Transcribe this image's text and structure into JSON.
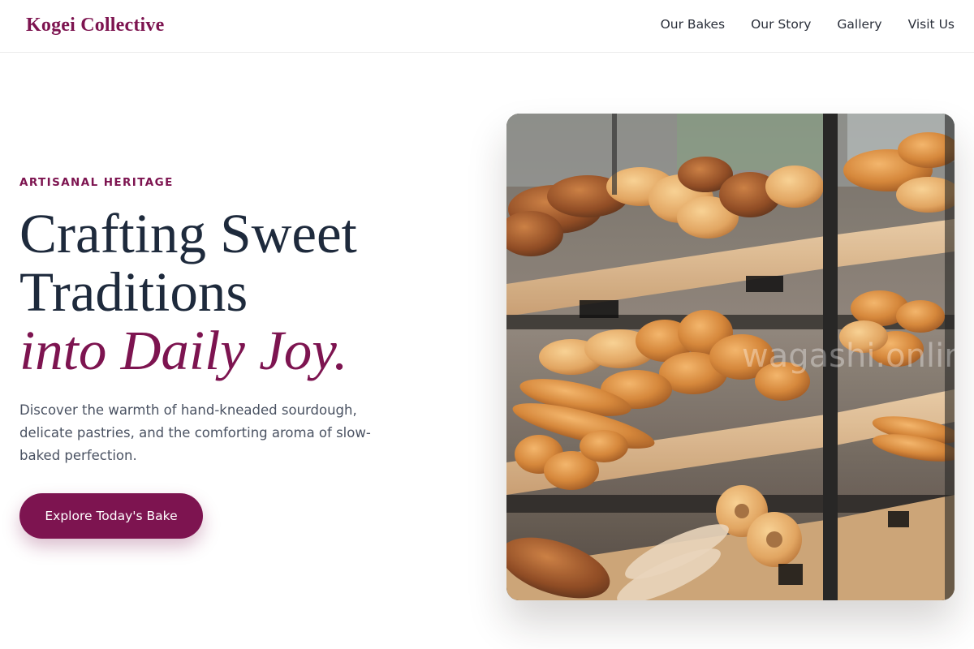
{
  "header": {
    "brand": "Kogei Collective",
    "nav": [
      {
        "label": "Our Bakes"
      },
      {
        "label": "Our Story"
      },
      {
        "label": "Gallery"
      },
      {
        "label": "Visit Us"
      }
    ]
  },
  "hero": {
    "eyebrow": "ARTISANAL HERITAGE",
    "headline_line1": "Crafting Sweet",
    "headline_line2": "Traditions",
    "headline_accent": "into Daily Joy.",
    "description": "Discover the warmth of hand-kneaded sourdough, delicate pastries, and the comforting aroma of slow-baked perfection.",
    "cta_label": "Explore Today's Bake",
    "image_alt": "Glass display case filled with breads and pastries",
    "watermark": "wagashi.online"
  },
  "colors": {
    "brand": "#7d1450",
    "heading": "#1e2a3c",
    "body_text": "#4a5262"
  }
}
